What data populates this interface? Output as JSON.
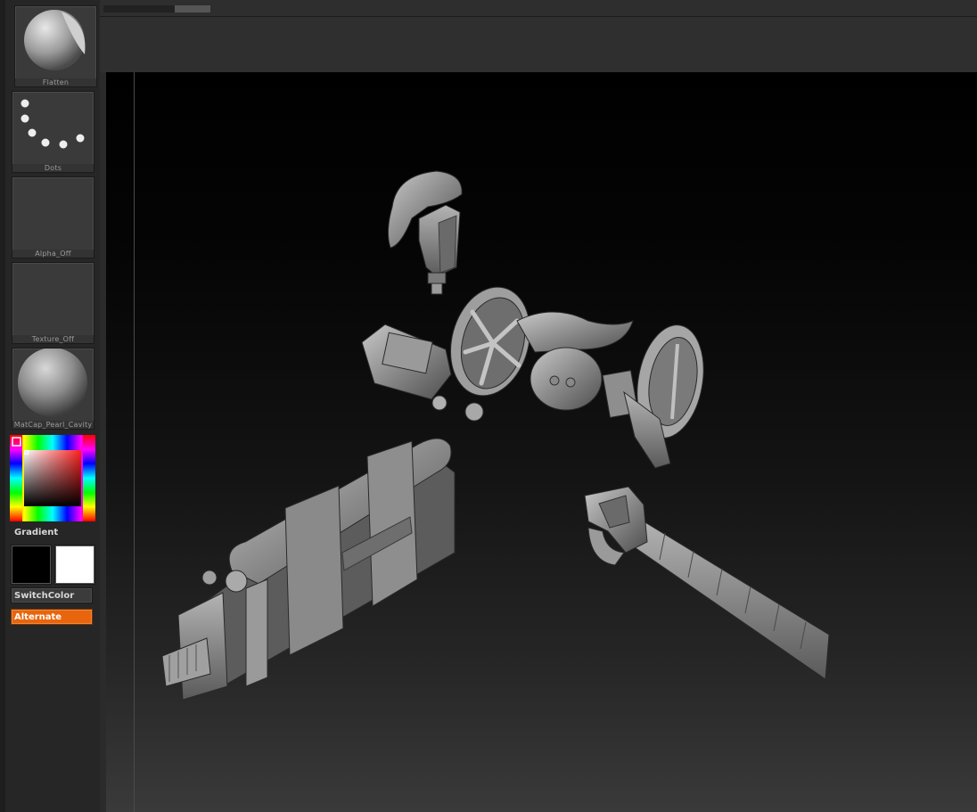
{
  "shelf": {
    "brush_label": "Flatten",
    "stroke_label": "Dots",
    "alpha_label": "Alpha_Off",
    "texture_label": "Texture_Off",
    "material_label": "MatCap_Pearl_Cavity",
    "gradient_label": "Gradient",
    "switch_color_label": "SwitchColor",
    "alternate_label": "Alternate",
    "main_color": "#000000",
    "secondary_color": "#ffffff",
    "accent_color": "#e8650e"
  },
  "canvas": {
    "models": [
      "grip-handle",
      "gas-canister-unit",
      "gear-reel-mechanism",
      "blade-hilt"
    ]
  }
}
